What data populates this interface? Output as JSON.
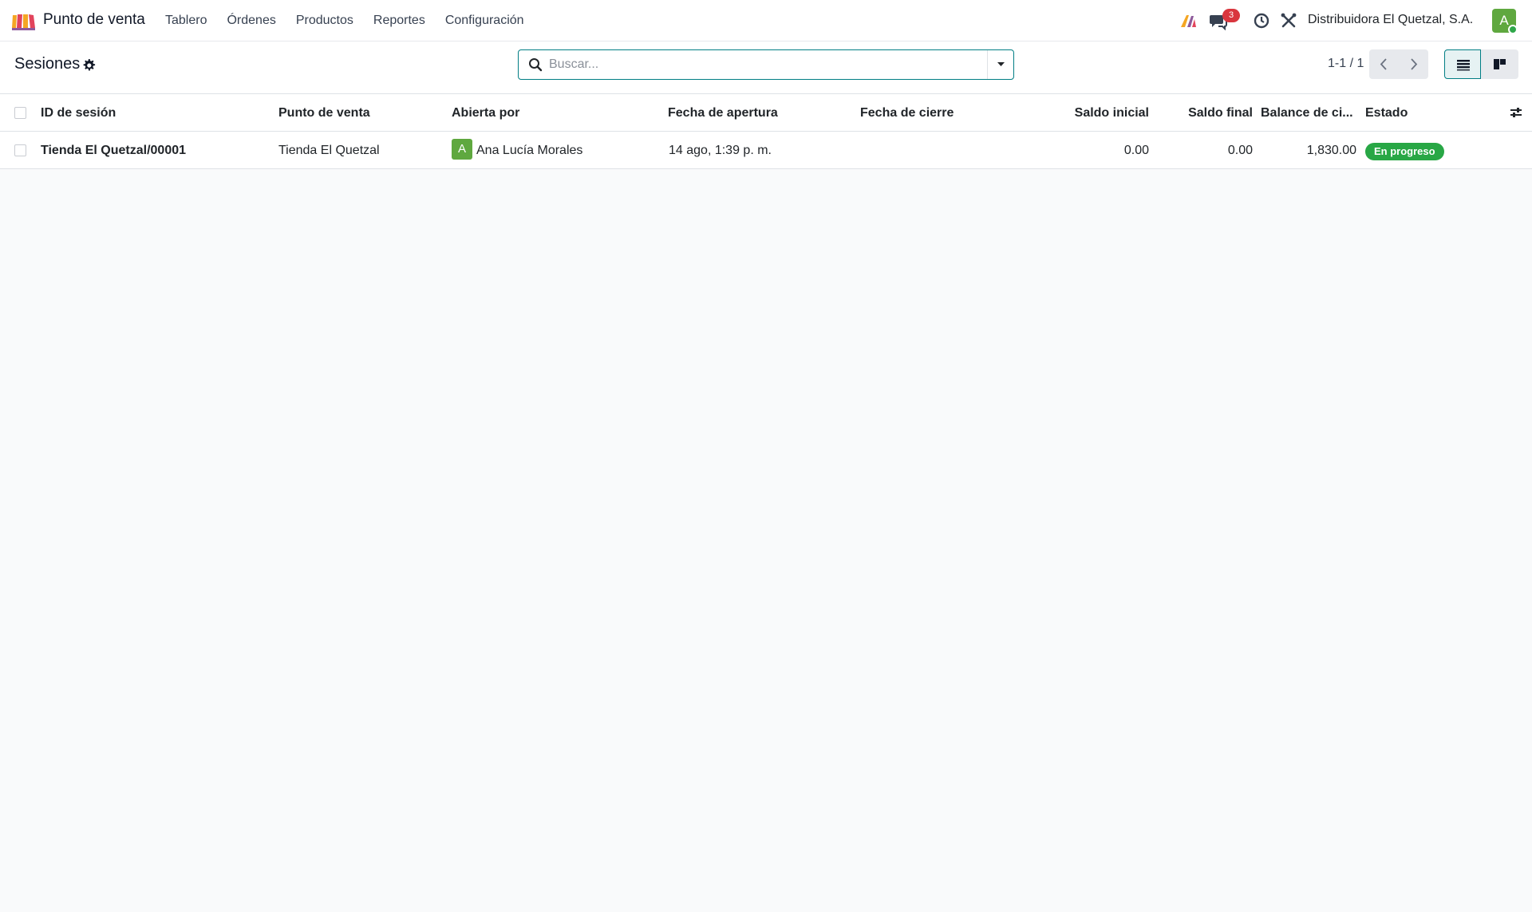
{
  "navbar": {
    "app_name": "Punto de venta",
    "menu": [
      "Tablero",
      "Órdenes",
      "Productos",
      "Reportes",
      "Configuración"
    ],
    "messages_count": "3",
    "company": "Distribuidora El Quetzal, S.A.",
    "user_initial": "A"
  },
  "control_panel": {
    "title": "Sesiones",
    "search_placeholder": "Buscar...",
    "pager": "1-1 / 1"
  },
  "table": {
    "columns": [
      "ID de sesión",
      "Punto de venta",
      "Abierta por",
      "Fecha de apertura",
      "Fecha de cierre",
      "Saldo inicial",
      "Saldo final",
      "Balance de ci...",
      "Estado"
    ],
    "rows": [
      {
        "session_id": "Tienda El Quetzal/00001",
        "pos": "Tienda El Quetzal",
        "opened_by_initial": "A",
        "opened_by": "Ana Lucía Morales",
        "open_date": "14 ago, 1:39 p. m.",
        "close_date": "",
        "opening_balance": "0.00",
        "closing_balance": "0.00",
        "close_balance": "1,830.00",
        "status": "En progreso"
      }
    ]
  },
  "colors": {
    "accent": "#017e84",
    "status_in_progress": "#28a745",
    "badge": "#d9363e",
    "avatar": "#5fa83f"
  }
}
